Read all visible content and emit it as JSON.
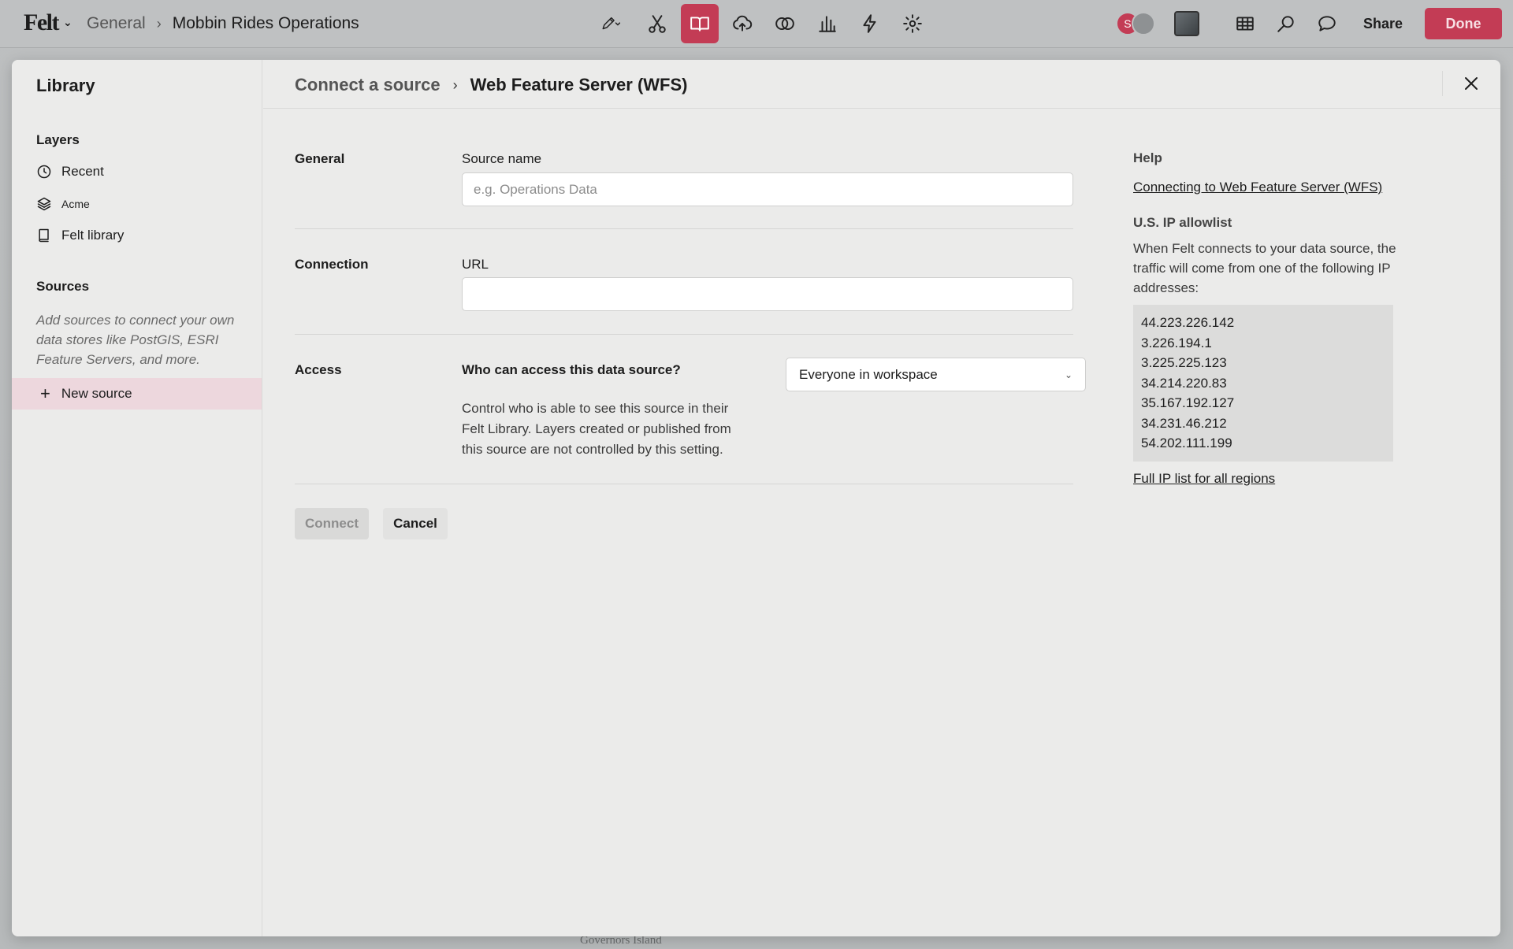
{
  "topbar": {
    "logo": "Felt",
    "breadcrumb_workspace": "General",
    "breadcrumb_map": "Mobbin Rides Operations",
    "avatar_initial": "S",
    "share_label": "Share",
    "done_label": "Done",
    "accent": "#c33c55"
  },
  "map": {
    "labels": [
      "Governors Island"
    ]
  },
  "library": {
    "title": "Library",
    "layers_label": "Layers",
    "items": [
      {
        "label": "Recent",
        "icon": "clock-icon"
      },
      {
        "label": "Acme",
        "icon": "layers-icon"
      },
      {
        "label": "Felt library",
        "icon": "book-icon"
      }
    ],
    "sources_label": "Sources",
    "sources_hint": "Add sources to connect your own data stores like PostGIS, ESRI Feature Servers, and more.",
    "new_source_label": "New source"
  },
  "main": {
    "breadcrumb_parent": "Connect a source",
    "breadcrumb_current": "Web Feature Server (WFS)",
    "general_label": "General",
    "source_name_label": "Source name",
    "source_name_placeholder": "e.g. Operations Data",
    "source_name_value": "",
    "connection_label": "Connection",
    "url_label": "URL",
    "url_value": "",
    "access_label": "Access",
    "access_question": "Who can access this data source?",
    "access_selected": "Everyone in workspace",
    "access_description": "Control who is able to see this source in their Felt Library. Layers created or published from this source are not controlled by this setting.",
    "connect_label": "Connect",
    "cancel_label": "Cancel"
  },
  "help": {
    "title": "Help",
    "link": "Connecting to Web Feature Server (WFS)",
    "allowlist_title": "U.S. IP allowlist",
    "allowlist_text": "When Felt connects to your data source, the traffic will come from one of the following IP addresses:",
    "ips": [
      "44.223.226.142",
      "3.226.194.1",
      "3.225.225.123",
      "34.214.220.83",
      "35.167.192.127",
      "34.231.46.212",
      "54.202.111.199"
    ],
    "full_list_link": "Full IP list for all regions"
  }
}
